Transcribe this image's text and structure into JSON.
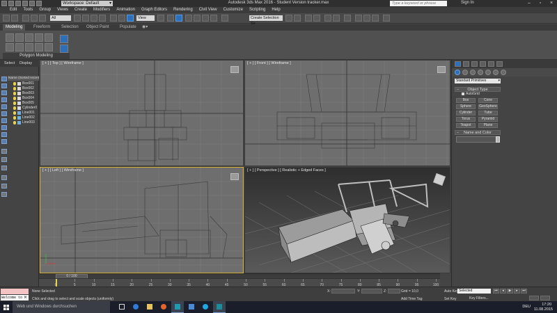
{
  "window": {
    "title": "Autodesk 3ds Max 2016 - Student Version   tracker.max",
    "workspace": "Workspace: Default",
    "search_placeholder": "Type a keyword or phrase",
    "sign_in": "Sign In"
  },
  "menu": [
    "Edit",
    "Tools",
    "Group",
    "Views",
    "Create",
    "Modifiers",
    "Animation",
    "Graph Editors",
    "Rendering",
    "Civil View",
    "Customize",
    "Scripting",
    "Help"
  ],
  "toolbar": {
    "filter": "All",
    "refcoord": "View",
    "selection_set": "Create Selection Se"
  },
  "ribbon": {
    "tabs": [
      "Modeling",
      "Freeform",
      "Selection",
      "Object Paint",
      "Populate"
    ],
    "active_tab": "Modeling",
    "panel_label": "Polygon Modeling"
  },
  "scene_explorer": {
    "tabs": [
      "Select",
      "Display"
    ],
    "header": "Name (Sorted Ascen",
    "objects": [
      "Box001",
      "Box002",
      "Box003",
      "Box004",
      "Box005",
      "Cylinder0",
      "Line001",
      "Line002",
      "Line003"
    ]
  },
  "viewports": {
    "top": "[ + ] [ Top ] [ Wireframe ]",
    "front": "[ + ] [ Front ] [ Wireframe ]",
    "left": "[ + ] [ Left ] [ Wireframe ]",
    "perspective": "[ + ] [ Perspective ] [ Realistic + Edged Faces ]"
  },
  "command_panel": {
    "category": "Standard Primitives",
    "object_type_title": "Object Type",
    "autogrid": "AutoGrid",
    "primitives": [
      "Box",
      "Cone",
      "Sphere",
      "GeoSphere",
      "Cylinder",
      "Tube",
      "Torus",
      "Pyramid",
      "Teapot",
      "Plane"
    ],
    "name_color_title": "Name and Color"
  },
  "timeline": {
    "slider": "0 / 100",
    "ticks": [
      "0",
      "5",
      "10",
      "15",
      "20",
      "25",
      "30",
      "35",
      "40",
      "45",
      "50",
      "55",
      "60",
      "65",
      "70",
      "75",
      "80",
      "85",
      "90",
      "95",
      "100"
    ],
    "current_frame": 0
  },
  "status": {
    "listener": "Welcome to M",
    "selection": "None Selected",
    "prompt": "Click and drag to select and scale objects (uniformly)",
    "x_label": "X:",
    "y_label": "Y:",
    "z_label": "Z:",
    "grid": "Grid = 10,0",
    "add_time_tag": "Add Time Tag",
    "auto_key": "Auto Key",
    "set_key": "Set Key",
    "selected": "Selected",
    "key_filters": "Key Filters..."
  },
  "taskbar": {
    "search": "Web und Windows durchsuchen",
    "language": "DEU",
    "time": "17:20",
    "date": "11.08.2015"
  },
  "colors": {
    "active_viewport_border": "#d6b036",
    "viewport_bg": "#6e6e6e",
    "accent_blue": "#2d6fb8"
  }
}
